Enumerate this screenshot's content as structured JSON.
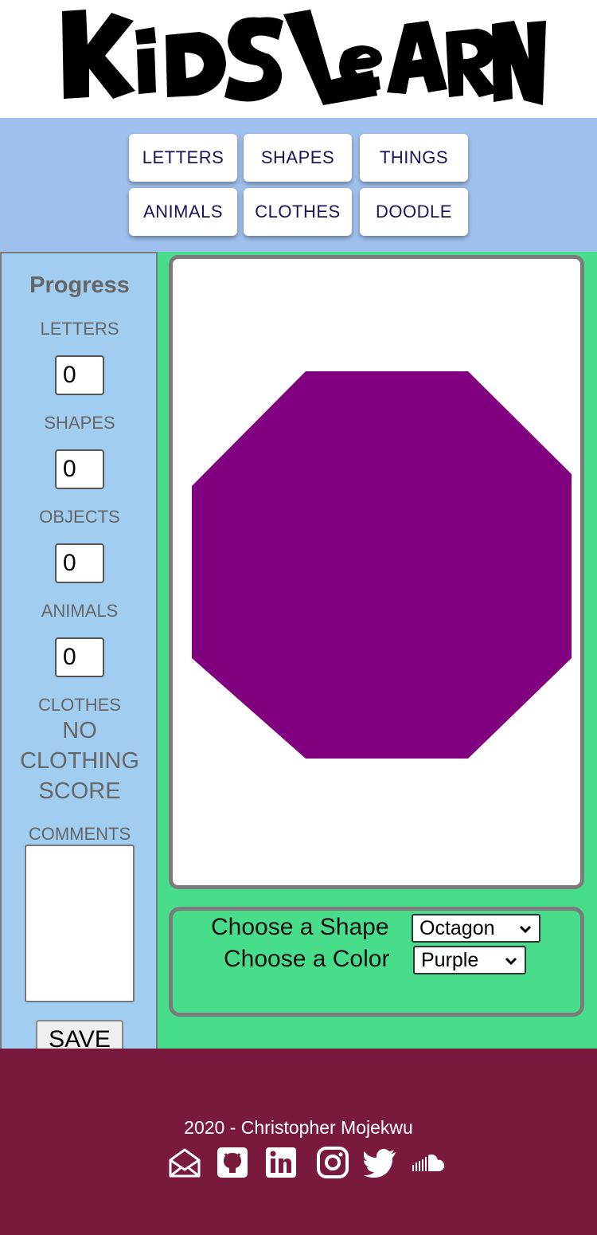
{
  "header": {
    "logo_text": "KidS LeaRN"
  },
  "nav": {
    "items": [
      {
        "label": "LETTERS"
      },
      {
        "label": "SHAPES"
      },
      {
        "label": "THINGS"
      },
      {
        "label": "ANIMALS"
      },
      {
        "label": "CLOTHES"
      },
      {
        "label": "DOODLE"
      }
    ]
  },
  "progress": {
    "title": "Progress",
    "letters_label": "LETTERS",
    "letters_value": "0",
    "shapes_label": "SHAPES",
    "shapes_value": "0",
    "objects_label": "OBJECTS",
    "objects_value": "0",
    "animals_label": "ANIMALS",
    "animals_value": "0",
    "clothes_label": "CLOTHES",
    "clothes_score": "NO CLOTHING SCORE",
    "comments_label": "COMMENTS",
    "comments_value": "",
    "save_label": "SAVE"
  },
  "canvas": {
    "shape": "octagon",
    "fill_color": "#800080"
  },
  "controls": {
    "shape_label": "Choose a Shape",
    "shape_selected": "Octagon",
    "color_label": "Choose a Color",
    "color_selected": "Purple"
  },
  "footer": {
    "credit": "2020 - Christopher Mojekwu",
    "social_icons": [
      "email-icon",
      "github-icon",
      "linkedin-icon",
      "instagram-icon",
      "twitter-icon",
      "soundcloud-icon"
    ]
  },
  "colors": {
    "nav_bg": "#a0c1ee",
    "sidebar_bg": "#a1cdf0",
    "main_bg": "#48dd8b",
    "footer_bg": "#7a193e",
    "nav_text": "#1a1458"
  }
}
